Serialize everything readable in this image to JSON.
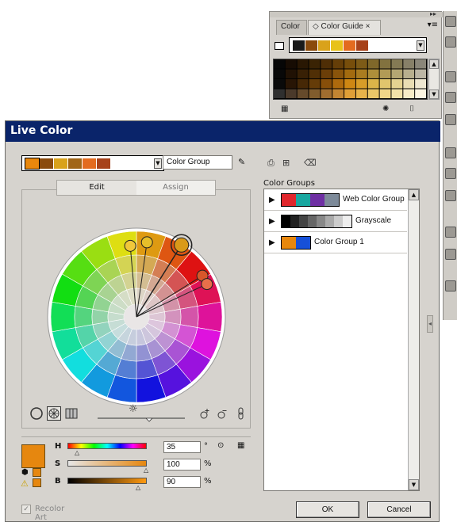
{
  "color_guide": {
    "tabs": [
      "Color",
      "◇ Color Guide ×"
    ],
    "panel_menu": "▸▸",
    "top_swatches": [
      "#1a1a1a",
      "#8a4a0c",
      "#d9a21b",
      "#e8c21a",
      "#e36b1f",
      "#a7421a"
    ],
    "grid_columns": [
      "#0a0a0a",
      "#2a1605",
      "#4a2a06",
      "#6a3f08",
      "#8f530a",
      "#b7700e",
      "#d98e14",
      "#e3a52a",
      "#e8bd4d",
      "#edcf73",
      "#f0dd99",
      "#f5e9bd",
      "#faf3dc"
    ],
    "grid_shades": [
      0.55,
      0.75,
      0.95,
      1.15
    ],
    "bottom_icons": [
      "grid-icon",
      "cog-icon",
      "new-icon"
    ]
  },
  "live_color": {
    "title": "Live Color",
    "active_swatches": [
      "#e8870d",
      "#8a4a0c",
      "#d9a21b",
      "#a16516",
      "#e36b1f",
      "#a7421a"
    ],
    "group_name": "Color Group",
    "tabs": {
      "edit": "Edit",
      "assign": "Assign"
    },
    "groups_label": "Color Groups",
    "groups": [
      {
        "name": "Web Color Group",
        "swatches": [
          "#e0262c",
          "#19a7a0",
          "#6e2fa3",
          "#7d8a99"
        ]
      },
      {
        "name": "Grayscale",
        "swatches": [
          "#000000",
          "#222222",
          "#444444",
          "#666666",
          "#888888",
          "#aaaaaa",
          "#cccccc",
          "#eeeeee"
        ]
      },
      {
        "name": "Color Group 1",
        "swatches": [
          "#e8870d",
          "#1650d8"
        ]
      }
    ],
    "hsb": {
      "h_label": "H",
      "h_value": "35",
      "h_unit": "°",
      "s_label": "S",
      "s_value": "100",
      "s_unit": "%",
      "b_label": "B",
      "b_value": "90",
      "b_unit": "%"
    },
    "current_color": "#e6870f",
    "recolor_label": "Recolor Art",
    "recolor_checked": true,
    "ok_label": "OK",
    "cancel_label": "Cancel",
    "wheel_markers": [
      {
        "color": "#d99a1a",
        "selected": true
      },
      {
        "color": "#e6bf2a",
        "selected": false
      },
      {
        "color": "#f0c83a",
        "selected": false
      },
      {
        "color": "#d7572a",
        "selected": false
      },
      {
        "color": "#e8704a",
        "selected": false
      }
    ]
  }
}
